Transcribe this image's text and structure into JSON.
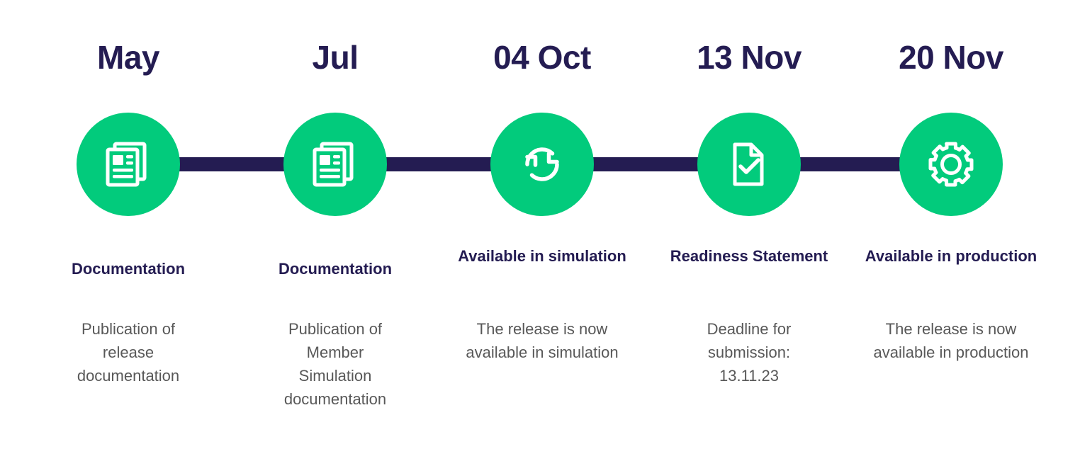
{
  "theme": {
    "accent_green": "#02CB7C",
    "navy": "#241C52",
    "body_gray": "#585858",
    "background": "#ffffff"
  },
  "timeline": {
    "milestones": [
      {
        "date": "May",
        "icon": "documents-icon",
        "label": "Documentation",
        "description": "Publication of release documentation"
      },
      {
        "date": "Jul",
        "icon": "documents-icon",
        "label": "Documentation",
        "description": "Publication of Member Simulation documentation"
      },
      {
        "date": "04 Oct",
        "icon": "sync-refresh-icon",
        "label": "Available in simulation",
        "description": "The release is now available in simulation"
      },
      {
        "date": "13 Nov",
        "icon": "document-check-icon",
        "label": "Readiness Statement",
        "description": "Deadline for submission: 13.11.23"
      },
      {
        "date": "20 Nov",
        "icon": "gear-icon",
        "label": "Available in production",
        "description": "The release is now available in production"
      }
    ]
  }
}
